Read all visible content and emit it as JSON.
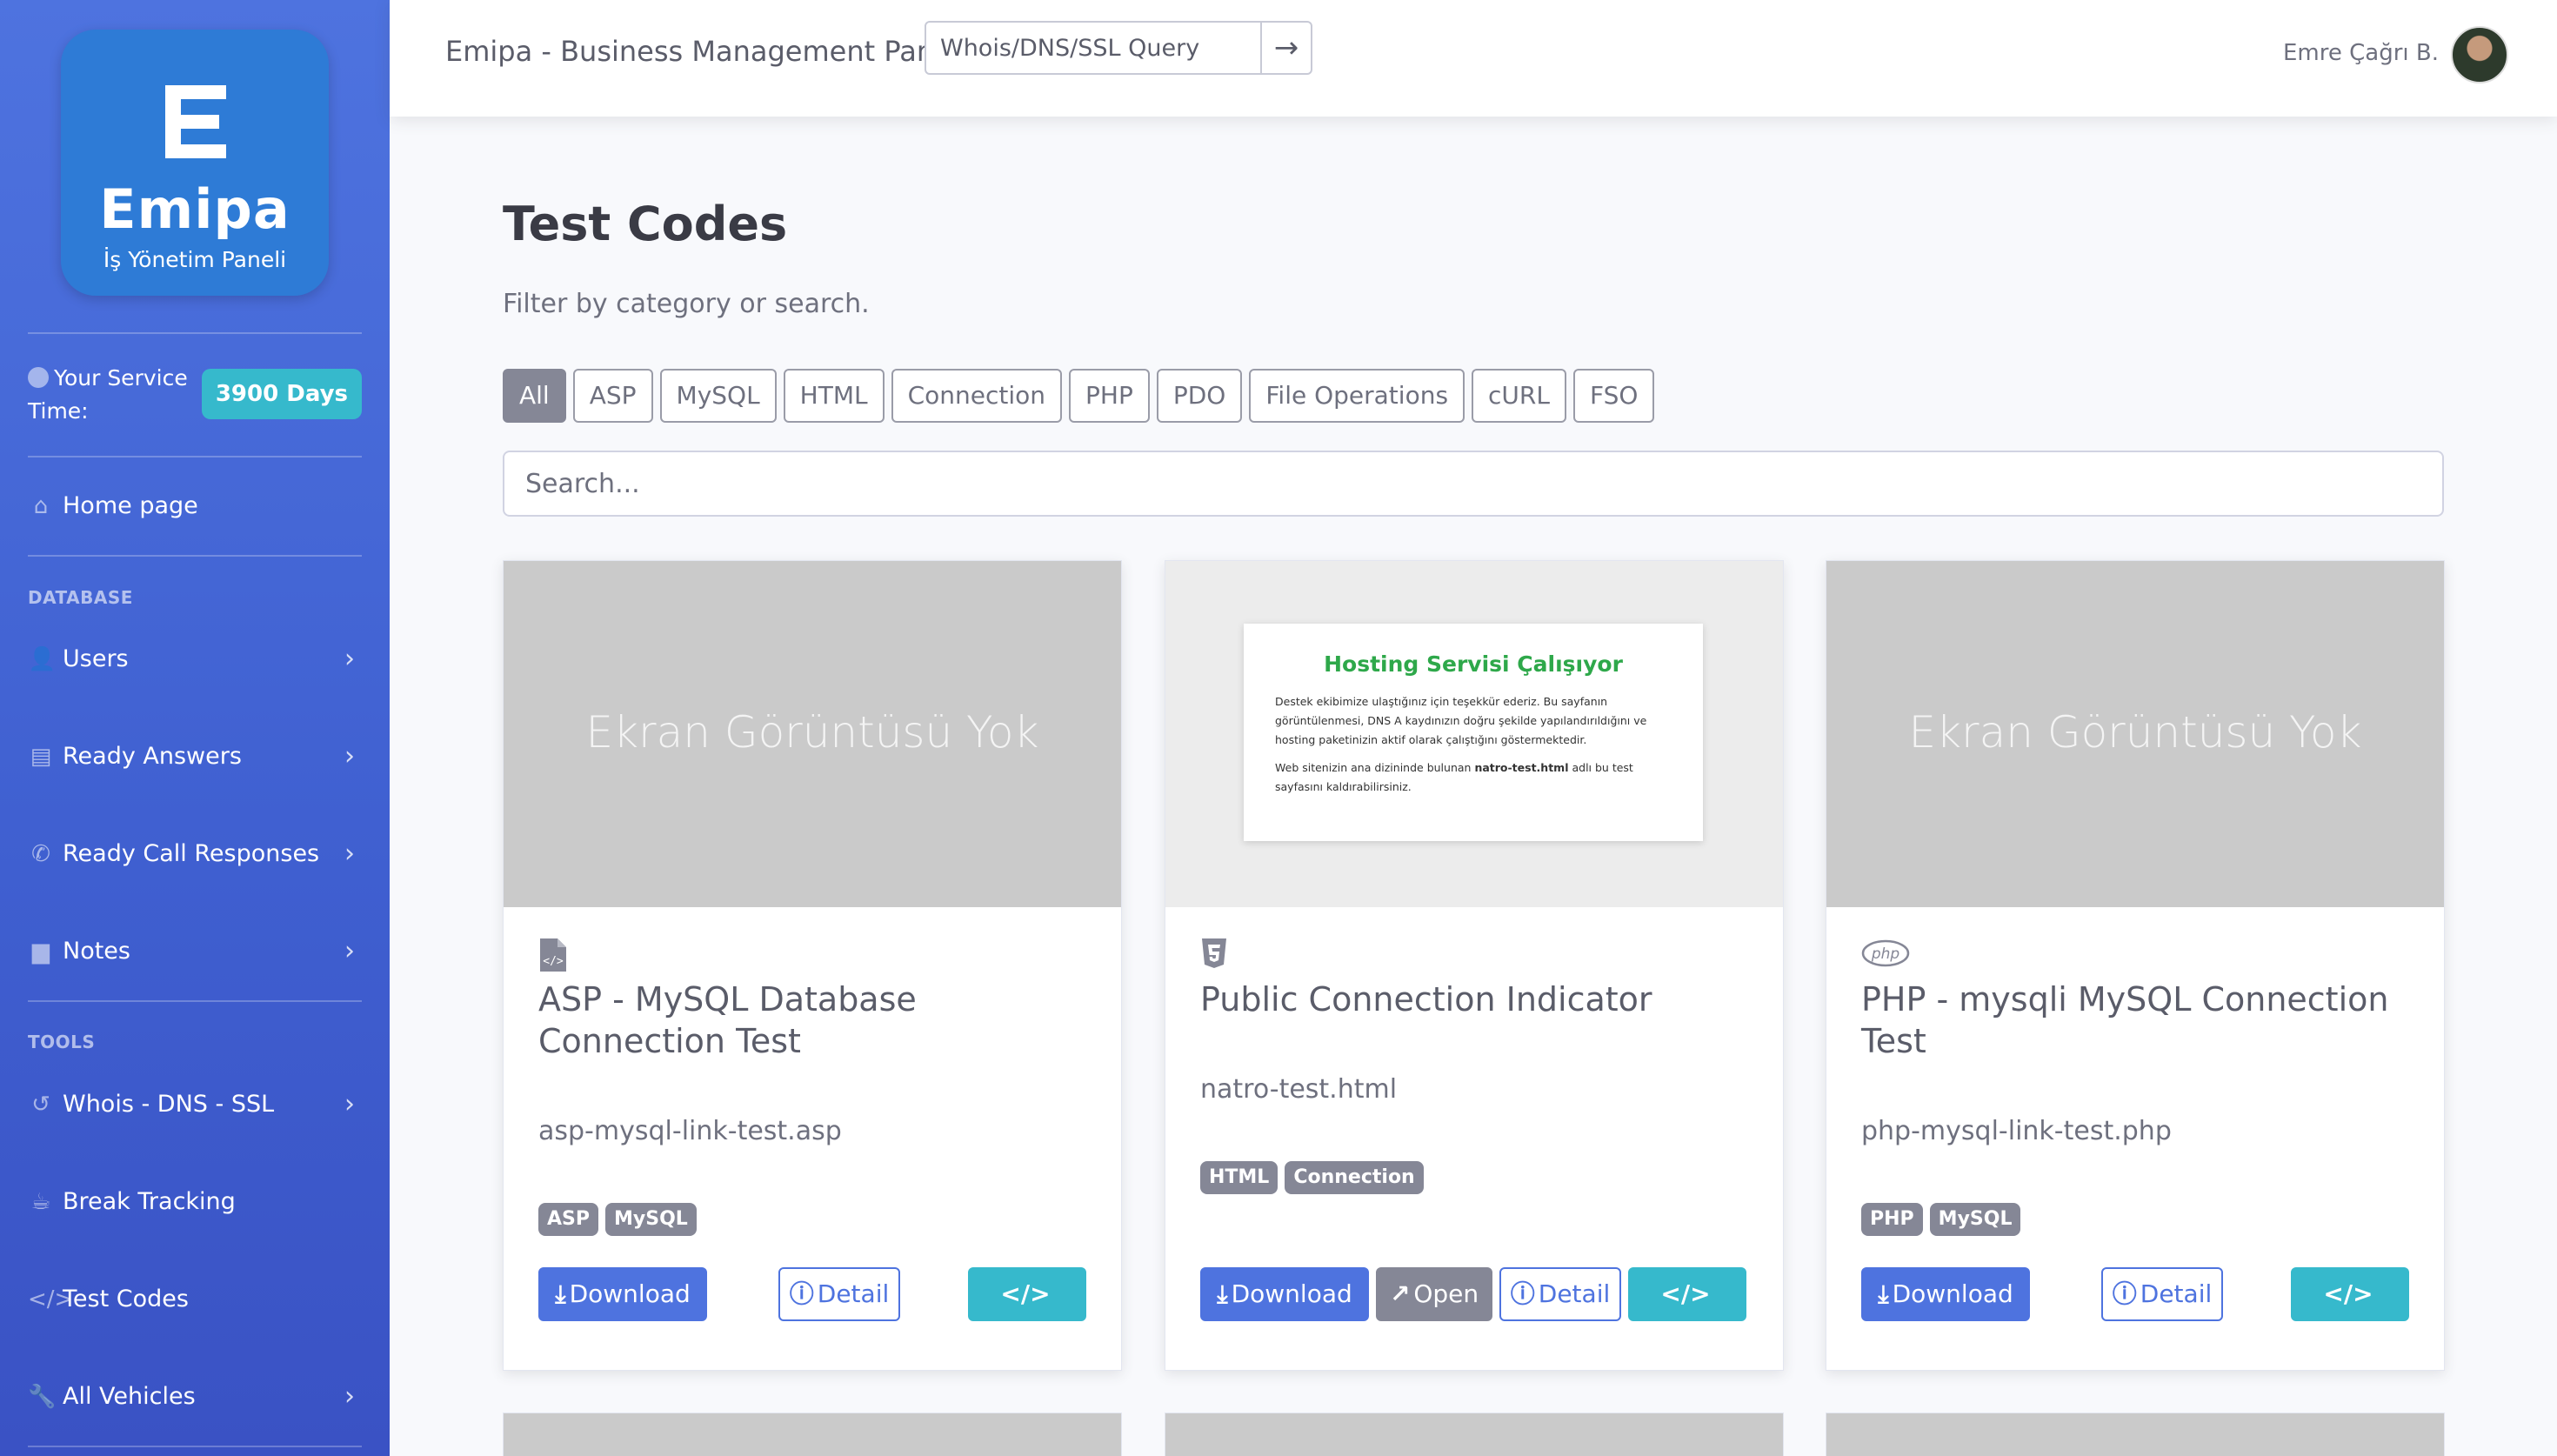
{
  "brand": {
    "letter": "E",
    "name": "Emipa",
    "subtitle": "İş Yönetim Paneli"
  },
  "sidebar": {
    "service_label": "Your Service Time:",
    "service_days": "3900 Days",
    "home": "Home page",
    "section_database": "DATABASE",
    "items_database": [
      "Users",
      "Ready Answers",
      "Ready Call Responses",
      "Notes"
    ],
    "section_tools": "TOOLS",
    "items_tools": [
      "Whois - DNS - SSL",
      "Break Tracking",
      "Test Codes",
      "All Vehicles"
    ]
  },
  "topbar": {
    "title": "Emipa - Business Management Panel",
    "query_placeholder": "Whois/DNS/SSL Query",
    "user_name": "Emre Çağrı B."
  },
  "page": {
    "title": "Test Codes",
    "subtitle": "Filter by category or search.",
    "filters": [
      "All",
      "ASP",
      "MySQL",
      "HTML",
      "Connection",
      "PHP",
      "PDO",
      "File Operations",
      "cURL",
      "FSO"
    ],
    "active_filter": "All",
    "search_placeholder": "Search..."
  },
  "cards": [
    {
      "icon": "file-code-icon",
      "no_image": "Ekran Görüntüsü Yok",
      "title": "ASP - MySQL Database Connection Test",
      "file": "asp-mysql-link-test.asp",
      "tags": [
        "ASP",
        "MySQL"
      ],
      "buttons": {
        "download": "Download",
        "detail": "Detail",
        "code": "Code"
      }
    },
    {
      "icon": "html5-icon",
      "preview_title": "Hosting Servisi Çalışıyor",
      "preview_p1": "Destek ekibimize ulaştığınız için teşekkür ederiz. Bu sayfanın görüntülenmesi, DNS A kaydınızın doğru şekilde yapılandırıldığını ve hosting paketinizin aktif olarak çalıştığını göstermektedir.",
      "preview_p2_a": "Web sitenizin ana dizininde bulunan ",
      "preview_p2_b": "natro-test.html",
      "preview_p2_c": " adlı bu test sayfasını kaldırabilirsiniz.",
      "title": "Public Connection Indicator",
      "file": "natro-test.html",
      "tags": [
        "HTML",
        "Connection"
      ],
      "buttons": {
        "download": "Download",
        "open": "Open",
        "detail": "Detail",
        "code": "Code"
      }
    },
    {
      "icon": "php-icon",
      "no_image": "Ekran Görüntüsü Yok",
      "title": "PHP - mysqli MySQL Connection Test",
      "file": "php-mysql-link-test.php",
      "tags": [
        "PHP",
        "MySQL"
      ],
      "buttons": {
        "download": "Download",
        "detail": "Detail",
        "code": "Code"
      }
    }
  ]
}
